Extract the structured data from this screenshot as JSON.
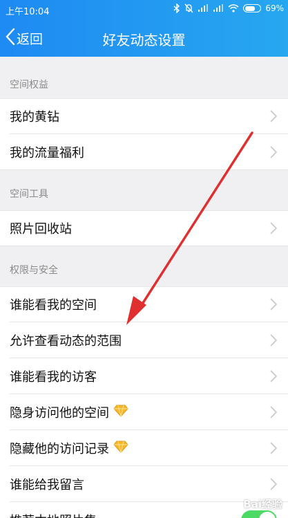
{
  "status_bar": {
    "time": "上午10:04",
    "battery": "69%",
    "battery_level": 0.69
  },
  "header": {
    "back_label": "返回",
    "title": "好友动态设置"
  },
  "sections": {
    "privilege": "空间权益",
    "tools": "空间工具",
    "security": "权限与安全"
  },
  "rows": {
    "yellow_diamond": "我的黄钻",
    "data_welfare": "我的流量福利",
    "photo_recycle": "照片回收站",
    "who_view_space": "谁能看我的空间",
    "allow_view_range": "允许查看动态的范围",
    "who_view_visitors": "谁能看我的访客",
    "stealth_visit": "隐身访问他的空间",
    "hide_visit_record": "隐藏他的访问记录",
    "who_leave_message": "谁能给我留言",
    "partial_bottom": "推荐本地照片集"
  },
  "watermark": "Bai经验",
  "colors": {
    "header": "#1e8af3",
    "arrow": "#e02f2f",
    "toggle_on": "#4cd964"
  }
}
